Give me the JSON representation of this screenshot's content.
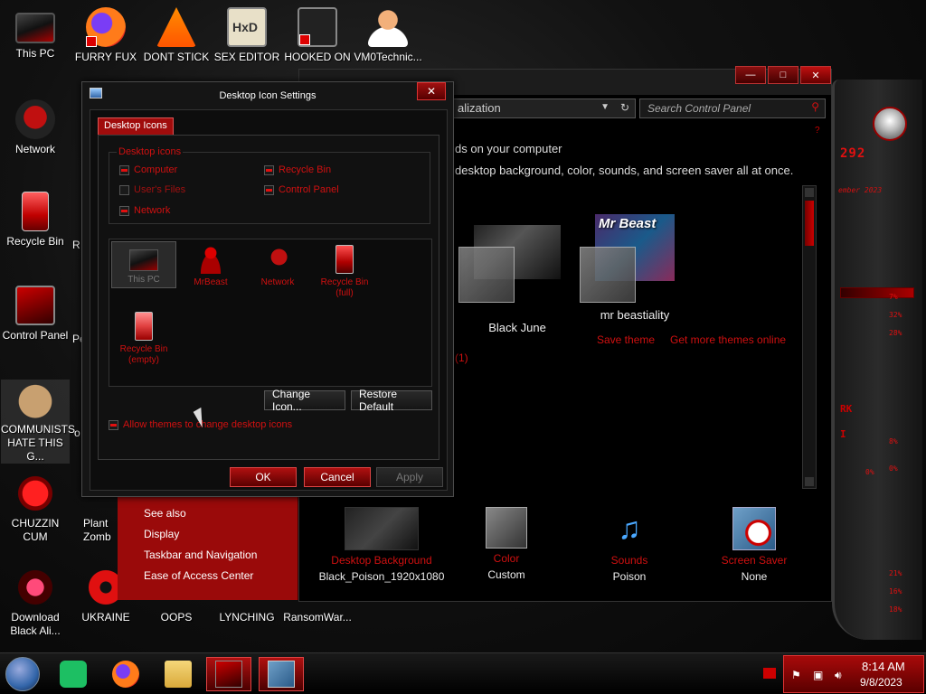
{
  "desktop": {
    "icons": [
      {
        "label": "This PC"
      },
      {
        "label": "FURRY FUX"
      },
      {
        "label": "DONT STICK"
      },
      {
        "label": "SEX EDITOR"
      },
      {
        "label": "HOOKED ON"
      },
      {
        "label": "VM0Technic..."
      },
      {
        "label": "Network"
      },
      {
        "label": "Recycle Bin"
      },
      {
        "label": "Control Panel"
      },
      {
        "label": "COMMUNISTS HATE THIS G..."
      },
      {
        "label": "CHUZZIN CUM"
      },
      {
        "label": "Download Black Ali..."
      },
      {
        "label": "UKRAINE"
      },
      {
        "label": "OOPS"
      },
      {
        "label": "LYNCHING"
      },
      {
        "label": "RansomWar..."
      }
    ],
    "partial_labels": [
      "Pe",
      "R",
      "o",
      "Plant",
      "Zomb"
    ],
    "hxd_text": "HxD"
  },
  "widget": {
    "big": "292",
    "small": "ember 2023",
    "pcts": [
      "7%",
      "32%",
      "28%",
      "8%",
      "0%",
      "0%",
      "21%",
      "16%",
      "18%"
    ],
    "side_text": [
      "RK",
      "I"
    ]
  },
  "personalization": {
    "address": "alization",
    "search_placeholder": "Search Control Panel",
    "help": "?",
    "text1": "ds on your computer",
    "text2": "desktop background, color, sounds, and screen saver all at once.",
    "themes": [
      {
        "name": "Black June"
      },
      {
        "name": "mr beastiality",
        "thumb_title": "Mr Beast"
      }
    ],
    "save_theme": "Save theme",
    "get_more": "Get more themes online",
    "count_frag": "(1)",
    "see_also": [
      "See also",
      "Display",
      "Taskbar and Navigation",
      "Ease of Access Center"
    ],
    "bottom": [
      {
        "title": "Desktop Background",
        "value": "Black_Poison_1920x1080"
      },
      {
        "title": "Color",
        "value": "Custom"
      },
      {
        "title": "Sounds",
        "value": "Poison"
      },
      {
        "title": "Screen Saver",
        "value": "None"
      }
    ],
    "window_buttons": [
      "—",
      "□",
      "✕"
    ]
  },
  "dialog": {
    "title": "Desktop Icon Settings",
    "close": "✕",
    "tab": "Desktop Icons",
    "group_legend": "Desktop icons",
    "checkboxes": [
      {
        "label": "Computer",
        "checked": true
      },
      {
        "label": "Recycle Bin",
        "checked": true
      },
      {
        "label": "User's Files",
        "checked": false
      },
      {
        "label": "Control Panel",
        "checked": true
      },
      {
        "label": "Network",
        "checked": true
      }
    ],
    "icon_list": [
      {
        "label": "This PC"
      },
      {
        "label": "MrBeast"
      },
      {
        "label": "Network"
      },
      {
        "label": "Recycle Bin (full)"
      },
      {
        "label": "Recycle Bin (empty)"
      }
    ],
    "change_icon": "Change Icon...",
    "restore_default": "Restore Default",
    "allow_themes": "Allow themes to change desktop icons",
    "ok": "OK",
    "cancel": "Cancel",
    "apply": "Apply"
  },
  "taskbar": {
    "time": "8:14 AM",
    "date": "9/8/2023"
  },
  "colors": {
    "accent": "#d01010",
    "dark": "#0d0d0d"
  }
}
